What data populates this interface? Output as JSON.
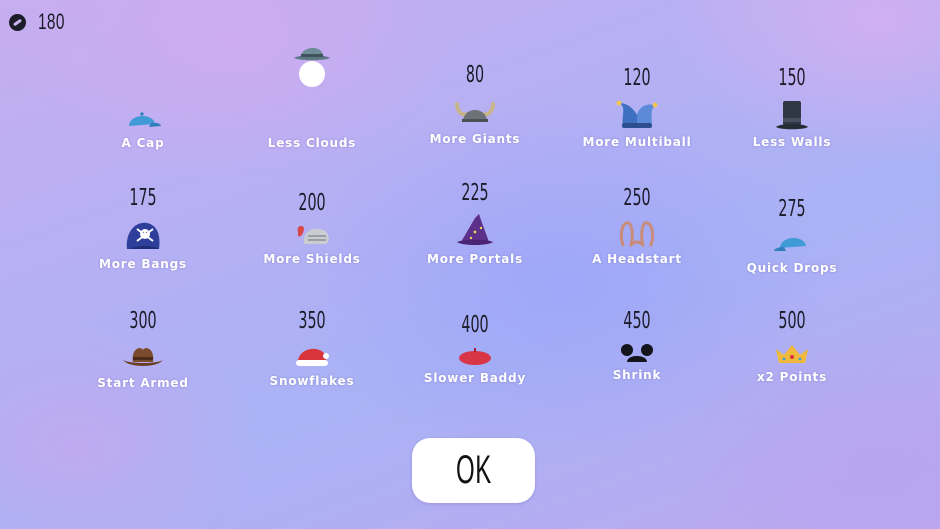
{
  "hud": {
    "coins": "180",
    "coin_icon": "coin-icon"
  },
  "items": [
    {
      "id": "cap",
      "price": "",
      "label": "A Cap",
      "icon": "blue-cap-icon"
    },
    {
      "id": "clouds",
      "price": "",
      "label": "Less Clouds",
      "icon": "fedora-hat-icon"
    },
    {
      "id": "giants",
      "price": "80",
      "label": "More Giants",
      "icon": "viking-helmet-icon"
    },
    {
      "id": "multiball",
      "price": "120",
      "label": "More Multiball",
      "icon": "jester-hat-icon"
    },
    {
      "id": "walls",
      "price": "150",
      "label": "Less Walls",
      "icon": "top-hat-icon"
    },
    {
      "id": "bangs",
      "price": "175",
      "label": "More Bangs",
      "icon": "pirate-hat-icon"
    },
    {
      "id": "shields",
      "price": "200",
      "label": "More Shields",
      "icon": "knight-helmet-icon"
    },
    {
      "id": "portals",
      "price": "225",
      "label": "More Portals",
      "icon": "wizard-hat-icon"
    },
    {
      "id": "headstart",
      "price": "250",
      "label": "A Headstart",
      "icon": "bunny-ears-icon"
    },
    {
      "id": "drops",
      "price": "275",
      "label": "Quick Drops",
      "icon": "backwards-cap-icon"
    },
    {
      "id": "armed",
      "price": "300",
      "label": "Start Armed",
      "icon": "cowboy-hat-icon"
    },
    {
      "id": "snow",
      "price": "350",
      "label": "Snowflakes",
      "icon": "santa-hat-icon"
    },
    {
      "id": "baddy",
      "price": "400",
      "label": "Slower Baddy",
      "icon": "beret-icon"
    },
    {
      "id": "shrink",
      "price": "450",
      "label": "Shrink",
      "icon": "mouse-ears-icon"
    },
    {
      "id": "points",
      "price": "500",
      "label": "x2 Points",
      "icon": "crown-icon"
    }
  ],
  "ok_button": {
    "label": "OK"
  },
  "colors": {
    "text_dark": "#1b1b28",
    "label_white": "#ffffff",
    "button_bg": "#ffffff"
  }
}
